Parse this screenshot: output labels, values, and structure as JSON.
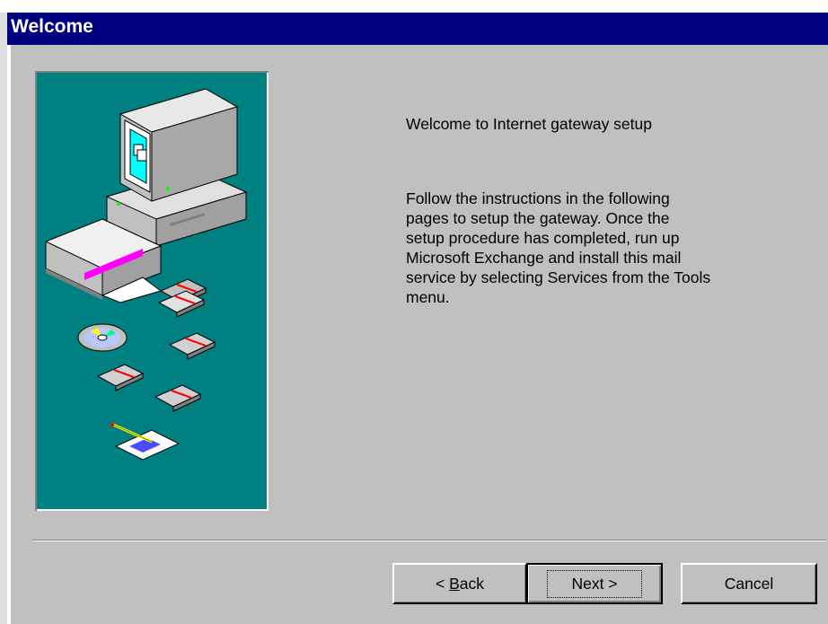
{
  "window": {
    "title": "Welcome"
  },
  "content": {
    "heading": "Welcome to Internet gateway setup",
    "body_lines": [
      "Follow the instructions in the following",
      "pages to setup the gateway. Once the",
      "setup procedure has completed, run up",
      "Microsoft Exchange and install this mail",
      "service by selecting Services from the Tools",
      "menu."
    ]
  },
  "buttons": {
    "back_prefix": "< ",
    "back_mnemonic": "B",
    "back_rest": "ack",
    "next": "Next >",
    "cancel": "Cancel"
  },
  "colors": {
    "titlebar": "#000080",
    "dialog_bg": "#c0c0c0",
    "art_bg": "#008080"
  },
  "icons": [
    "computer-icon",
    "software-box-icon",
    "cd-icon",
    "floppy-disk-icon",
    "notepad-pencil-icon"
  ]
}
